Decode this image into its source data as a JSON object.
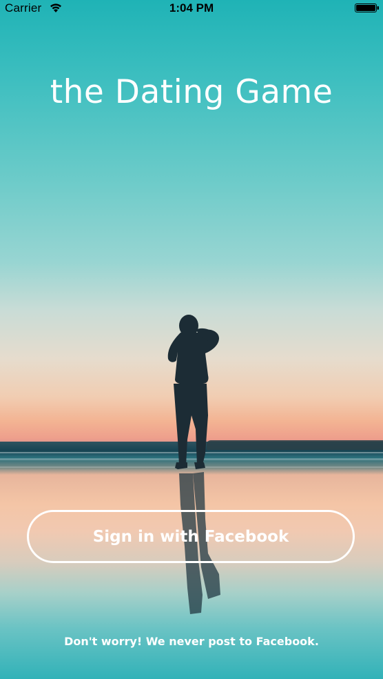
{
  "status_bar": {
    "carrier": "Carrier",
    "time": "1:04 PM",
    "wifi_icon": "wifi-icon",
    "battery_icon": "battery-full-icon"
  },
  "app": {
    "title": "the Dating Game"
  },
  "login": {
    "facebook_button_label": "Sign in with Facebook",
    "disclaimer": "Don't worry! We never post to Facebook."
  },
  "colors": {
    "sky_top": "#1fb3b6",
    "sunset": "#f3b493",
    "text": "#ffffff"
  }
}
